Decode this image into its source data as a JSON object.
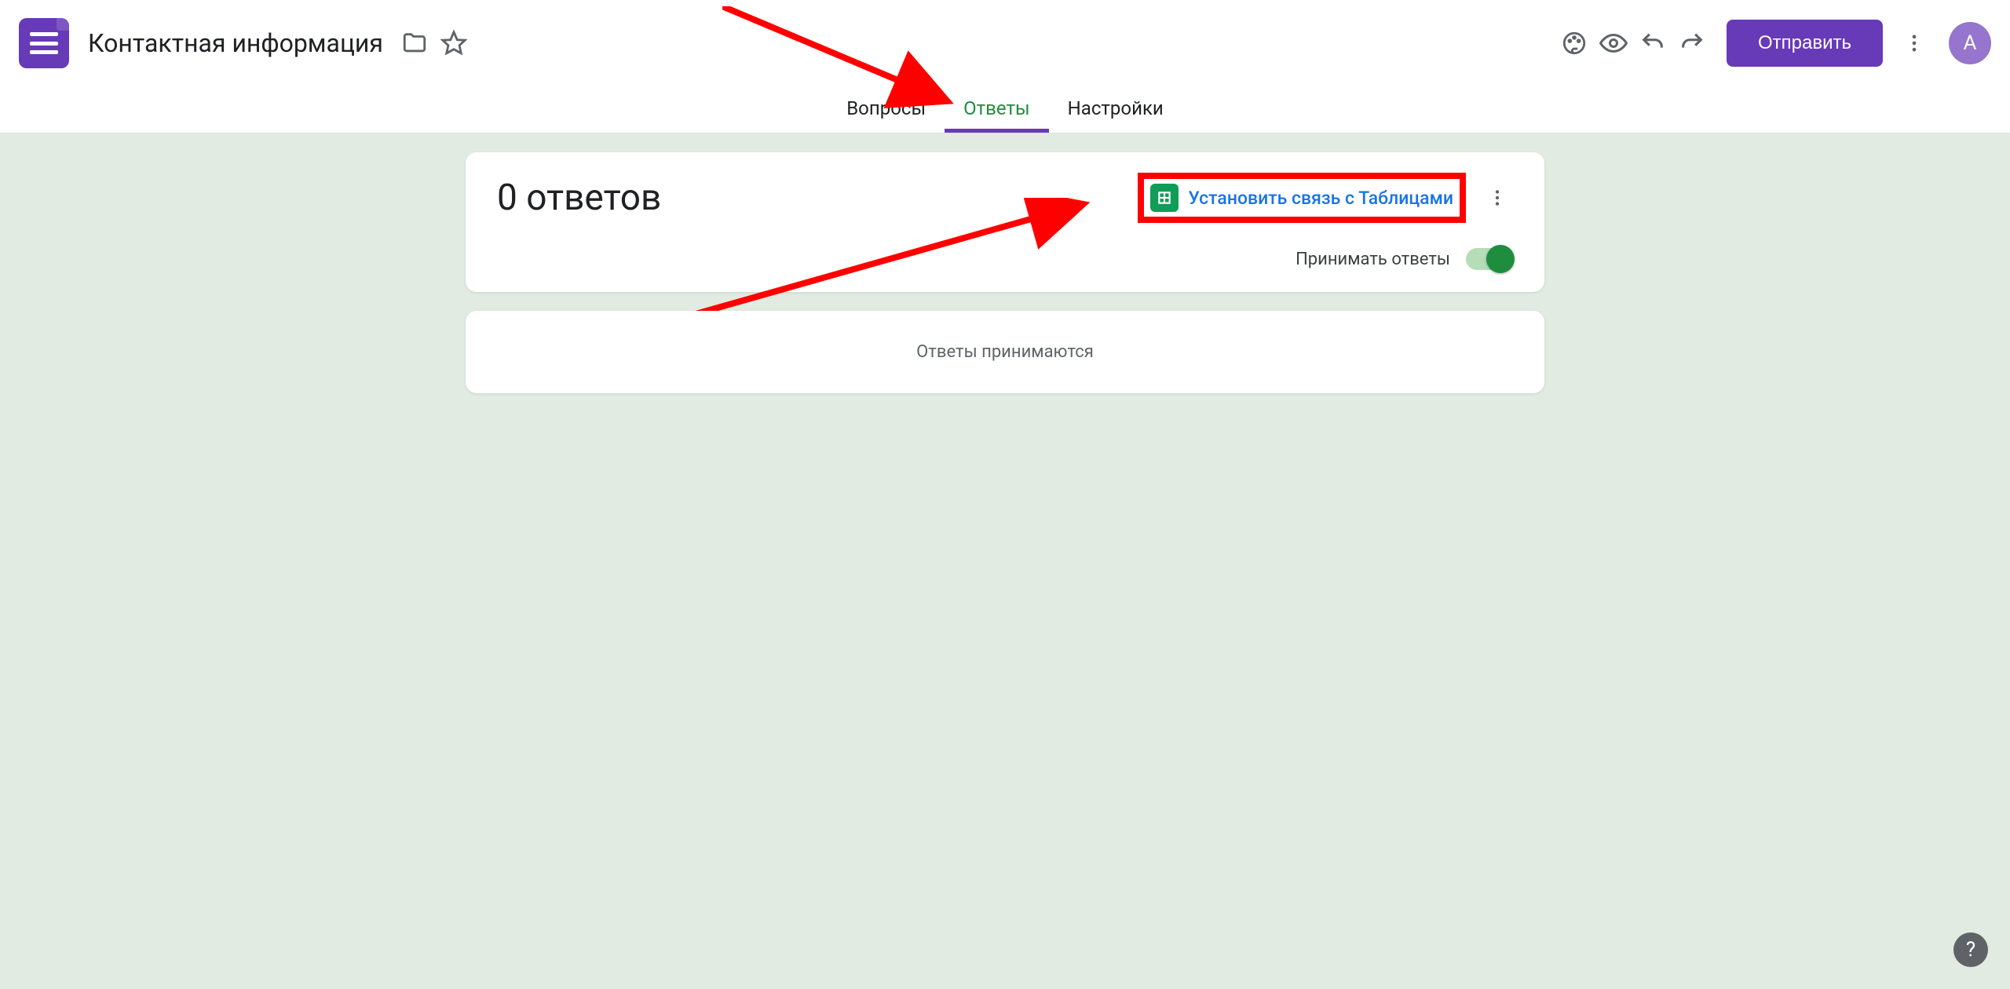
{
  "header": {
    "doc_title": "Контактная информация",
    "send_label": "Отправить",
    "avatar_letter": "А"
  },
  "tabs": {
    "questions": "Вопросы",
    "responses": "Ответы",
    "settings": "Настройки"
  },
  "responses_card": {
    "count_title": "0 ответов",
    "link_sheets_label": "Установить связь с Таблицами",
    "accept_label": "Принимать ответы"
  },
  "status_card": {
    "message": "Ответы принимаются"
  },
  "colors": {
    "accent": "#673ab7",
    "green": "#1e8e3e",
    "link": "#1a73e8",
    "page_bg": "#e1ebe2"
  }
}
